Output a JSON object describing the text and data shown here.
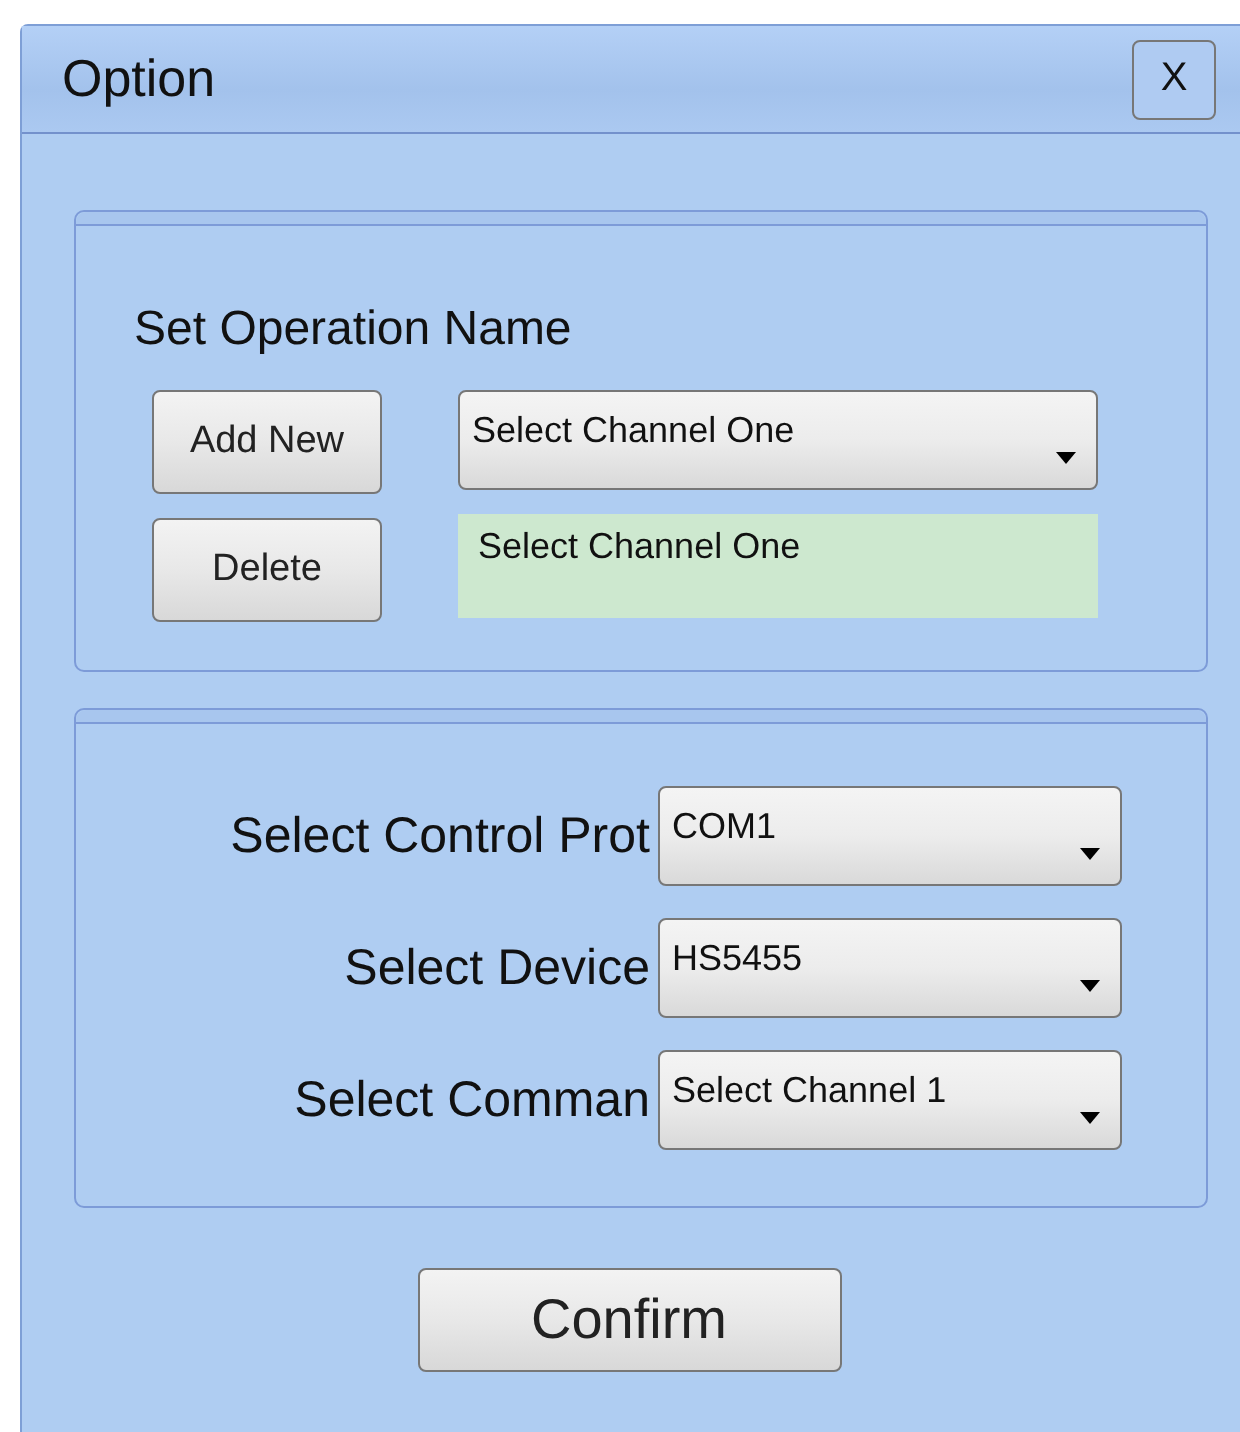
{
  "window": {
    "title": "Option",
    "close_label": "X"
  },
  "operation_panel": {
    "heading": "Set Operation Name",
    "buttons": [
      "Add New",
      "Delete"
    ],
    "dropdown": {
      "value": "Select Channel One"
    },
    "name_field": {
      "value": "Select Channel One"
    }
  },
  "settings_panel": {
    "rows": [
      {
        "label": "Select Control Prot",
        "value": "COM1"
      },
      {
        "label": "Select Device",
        "value": "HS5455"
      },
      {
        "label": "Select Comman",
        "value": "Select Channel 1"
      }
    ]
  },
  "confirm_button": "Confirm"
}
